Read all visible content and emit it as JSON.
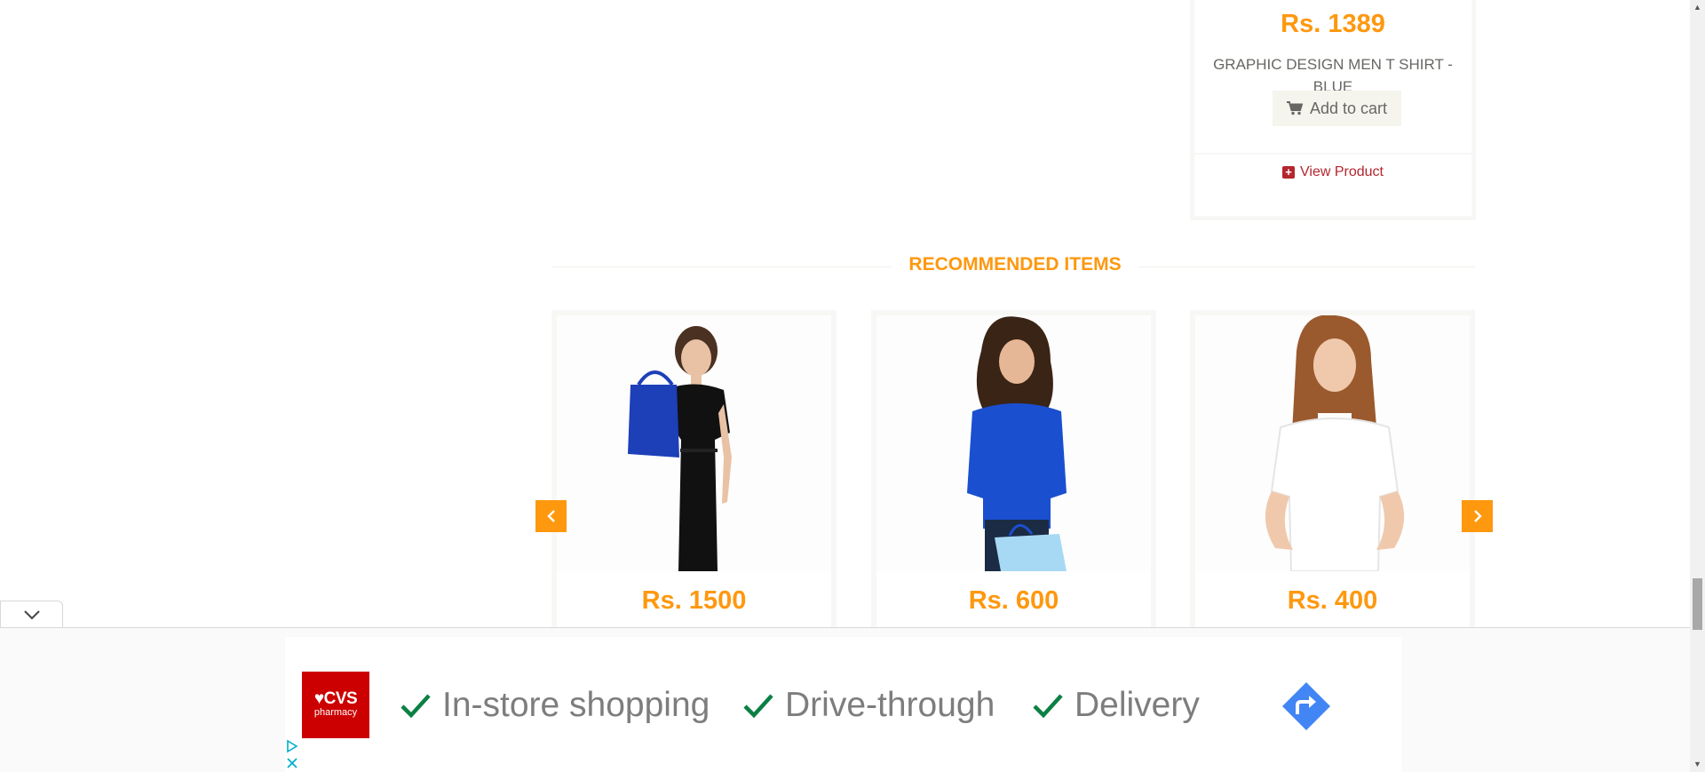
{
  "top_product": {
    "price": "Rs. 1389",
    "name": "GRAPHIC DESIGN MEN T SHIRT - BLUE",
    "add_to_cart": "Add to cart",
    "view_product": "View Product"
  },
  "recommended": {
    "title": "RECOMMENDED ITEMS",
    "items": [
      {
        "price": "Rs. 1500",
        "image": "woman-black-dress-blue-bag"
      },
      {
        "price": "Rs. 600",
        "image": "woman-blue-top-shopping-bag"
      },
      {
        "price": "Rs. 400",
        "image": "woman-white-tshirt"
      }
    ],
    "prev_icon": "chevron-left-icon",
    "next_icon": "chevron-right-icon"
  },
  "ad": {
    "brand_top": "♥CVS",
    "brand_bottom": "pharmacy",
    "features": [
      "In-store shopping",
      "Drive-through",
      "Delivery"
    ]
  },
  "colors": {
    "accent": "#FE980F",
    "link": "#B4262E",
    "text": "#696763",
    "cvs_red": "#CC0000",
    "check_green": "#0B8043",
    "directions_blue": "#4285F4"
  }
}
